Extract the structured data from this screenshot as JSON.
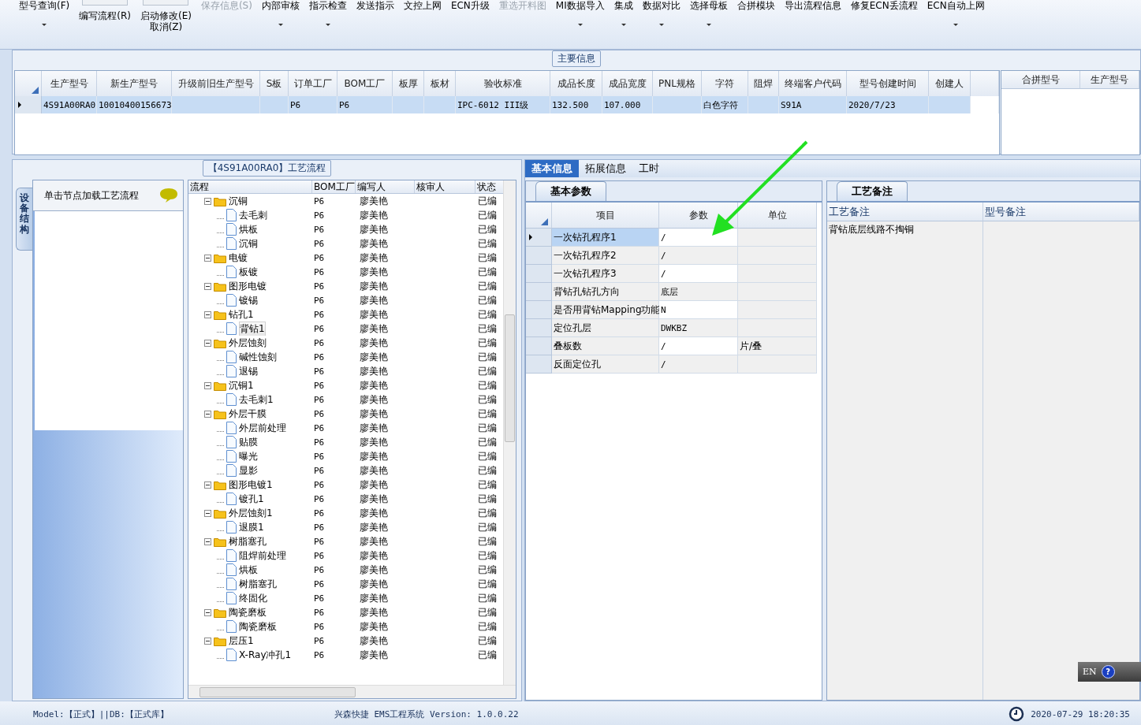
{
  "toolbar": [
    {
      "label": "型号查询(F)",
      "kind": "text",
      "dropdown": true,
      "disabled": false
    },
    {
      "label": "编写流程(R)",
      "kind": "stacked",
      "dropdown": false,
      "disabled": false
    },
    {
      "label": "启动修改(E)",
      "sublabel": "取消(Z)",
      "kind": "stacked",
      "dropdown": false,
      "disabled": false
    },
    {
      "label": "保存信息(S)",
      "kind": "text",
      "dropdown": false,
      "disabled": true
    },
    {
      "label": "内部审核",
      "kind": "text",
      "dropdown": true,
      "disabled": false
    },
    {
      "label": "指示检查",
      "kind": "text",
      "dropdown": true,
      "disabled": false
    },
    {
      "label": "发送指示",
      "kind": "text",
      "dropdown": false,
      "disabled": false
    },
    {
      "label": "文控上网",
      "kind": "text",
      "dropdown": false,
      "disabled": false
    },
    {
      "label": "ECN升级",
      "kind": "text",
      "dropdown": false,
      "disabled": false
    },
    {
      "label": "重选开料图",
      "kind": "text",
      "dropdown": false,
      "disabled": true
    },
    {
      "label": "MI数据导入",
      "kind": "text",
      "dropdown": true,
      "disabled": false
    },
    {
      "label": "集成",
      "kind": "text",
      "dropdown": true,
      "disabled": false
    },
    {
      "label": "数据对比",
      "kind": "text",
      "dropdown": true,
      "disabled": false
    },
    {
      "label": "选择母板",
      "kind": "text",
      "dropdown": true,
      "disabled": false
    },
    {
      "label": "合拼模块",
      "kind": "text",
      "dropdown": false,
      "disabled": false
    },
    {
      "label": "导出流程信息",
      "kind": "text",
      "dropdown": false,
      "disabled": false
    },
    {
      "label": "修复ECN丢流程",
      "kind": "text",
      "dropdown": false,
      "disabled": false
    },
    {
      "label": "ECN自动上网",
      "kind": "text",
      "dropdown": true,
      "disabled": false
    }
  ],
  "main_info": {
    "title": "主要信息",
    "columns": [
      "生产型号",
      "新生产型号",
      "升级前旧生产型号",
      "S板",
      "订单工厂",
      "BOM工厂",
      "板厚",
      "板材",
      "验收标准",
      "成品长度",
      "成品宽度",
      "PNL规格",
      "字符",
      "阻焊",
      "终端客户代码",
      "型号创建时间",
      "创建人"
    ],
    "rows": [
      {
        "selected": true,
        "cells": [
          "4S91A00RA0",
          "10010400156673",
          null,
          null,
          "P6",
          "P6",
          null,
          null,
          "IPC-6012 III级",
          "132.500",
          "107.000",
          null,
          "白色字符",
          null,
          "S91A",
          "2020/7/23",
          null
        ]
      }
    ],
    "merge_columns": [
      "合拼型号",
      "生产型号"
    ]
  },
  "process_panel": {
    "title": "【4S91A00RA0】工艺流程",
    "side_tab": "设备结构",
    "hint": "单击节点加载工艺流程",
    "columns": [
      "流程",
      "BOM工厂",
      "编写人",
      "核审人",
      "状态"
    ],
    "nodes": [
      {
        "kind": "folder",
        "name": "沉铜",
        "bom": "P6",
        "writer": "廖美艳",
        "status": "已编",
        "selected": false,
        "expanded": true,
        "children": [
          {
            "kind": "file",
            "name": "去毛刺",
            "bom": "P6",
            "writer": "廖美艳",
            "status": "已编",
            "selected": false
          },
          {
            "kind": "file",
            "name": "烘板",
            "bom": "P6",
            "writer": "廖美艳",
            "status": "已编",
            "selected": false
          },
          {
            "kind": "file",
            "name": "沉铜",
            "bom": "P6",
            "writer": "廖美艳",
            "status": "已编",
            "selected": false
          }
        ]
      },
      {
        "kind": "folder",
        "name": "电镀",
        "bom": "P6",
        "writer": "廖美艳",
        "status": "已编",
        "selected": false,
        "expanded": true,
        "children": [
          {
            "kind": "file",
            "name": "板镀",
            "bom": "P6",
            "writer": "廖美艳",
            "status": "已编",
            "selected": false
          }
        ]
      },
      {
        "kind": "folder",
        "name": "图形电镀",
        "bom": "P6",
        "writer": "廖美艳",
        "status": "已编",
        "selected": false,
        "expanded": true,
        "children": [
          {
            "kind": "file",
            "name": "镀锡",
            "bom": "P6",
            "writer": "廖美艳",
            "status": "已编",
            "selected": false
          }
        ]
      },
      {
        "kind": "folder",
        "name": "钻孔1",
        "bom": "P6",
        "writer": "廖美艳",
        "status": "已编",
        "selected": false,
        "expanded": true,
        "children": [
          {
            "kind": "file",
            "name": "背钻1",
            "bom": "P6",
            "writer": "廖美艳",
            "status": "已编",
            "selected": true
          }
        ]
      },
      {
        "kind": "folder",
        "name": "外层蚀刻",
        "bom": "P6",
        "writer": "廖美艳",
        "status": "已编",
        "selected": false,
        "expanded": true,
        "children": [
          {
            "kind": "file",
            "name": "碱性蚀刻",
            "bom": "P6",
            "writer": "廖美艳",
            "status": "已编",
            "selected": false
          },
          {
            "kind": "file",
            "name": "退锡",
            "bom": "P6",
            "writer": "廖美艳",
            "status": "已编",
            "selected": false
          }
        ]
      },
      {
        "kind": "folder",
        "name": "沉铜1",
        "bom": "P6",
        "writer": "廖美艳",
        "status": "已编",
        "selected": false,
        "expanded": true,
        "children": [
          {
            "kind": "file",
            "name": "去毛刺1",
            "bom": "P6",
            "writer": "廖美艳",
            "status": "已编",
            "selected": false
          }
        ]
      },
      {
        "kind": "folder",
        "name": "外层干膜",
        "bom": "P6",
        "writer": "廖美艳",
        "status": "已编",
        "selected": false,
        "expanded": true,
        "children": [
          {
            "kind": "file",
            "name": "外层前处理",
            "bom": "P6",
            "writer": "廖美艳",
            "status": "已编",
            "selected": false
          },
          {
            "kind": "file",
            "name": "贴膜",
            "bom": "P6",
            "writer": "廖美艳",
            "status": "已编",
            "selected": false
          },
          {
            "kind": "file",
            "name": "曝光",
            "bom": "P6",
            "writer": "廖美艳",
            "status": "已编",
            "selected": false
          },
          {
            "kind": "file",
            "name": "显影",
            "bom": "P6",
            "writer": "廖美艳",
            "status": "已编",
            "selected": false
          }
        ]
      },
      {
        "kind": "folder",
        "name": "图形电镀1",
        "bom": "P6",
        "writer": "廖美艳",
        "status": "已编",
        "selected": false,
        "expanded": true,
        "children": [
          {
            "kind": "file",
            "name": "镀孔1",
            "bom": "P6",
            "writer": "廖美艳",
            "status": "已编",
            "selected": false
          }
        ]
      },
      {
        "kind": "folder",
        "name": "外层蚀刻1",
        "bom": "P6",
        "writer": "廖美艳",
        "status": "已编",
        "selected": false,
        "expanded": true,
        "children": [
          {
            "kind": "file",
            "name": "退膜1",
            "bom": "P6",
            "writer": "廖美艳",
            "status": "已编",
            "selected": false
          }
        ]
      },
      {
        "kind": "folder",
        "name": "树脂塞孔",
        "bom": "P6",
        "writer": "廖美艳",
        "status": "已编",
        "selected": false,
        "expanded": true,
        "children": [
          {
            "kind": "file",
            "name": "阻焊前处理",
            "bom": "P6",
            "writer": "廖美艳",
            "status": "已编",
            "selected": false
          },
          {
            "kind": "file",
            "name": "烘板",
            "bom": "P6",
            "writer": "廖美艳",
            "status": "已编",
            "selected": false
          },
          {
            "kind": "file",
            "name": "树脂塞孔",
            "bom": "P6",
            "writer": "廖美艳",
            "status": "已编",
            "selected": false
          },
          {
            "kind": "file",
            "name": "终固化",
            "bom": "P6",
            "writer": "廖美艳",
            "status": "已编",
            "selected": false
          }
        ]
      },
      {
        "kind": "folder",
        "name": "陶瓷磨板",
        "bom": "P6",
        "writer": "廖美艳",
        "status": "已编",
        "selected": false,
        "expanded": true,
        "children": [
          {
            "kind": "file",
            "name": "陶瓷磨板",
            "bom": "P6",
            "writer": "廖美艳",
            "status": "已编",
            "selected": false
          }
        ]
      },
      {
        "kind": "folder",
        "name": "层压1",
        "bom": "P6",
        "writer": "廖美艳",
        "status": "已编",
        "selected": false,
        "expanded": true,
        "children": [
          {
            "kind": "file",
            "name": "X-Ray冲孔1",
            "bom": "P6",
            "writer": "廖美艳",
            "status": "已编",
            "selected": false
          }
        ]
      }
    ]
  },
  "detail_tabs": [
    {
      "label": "基本信息",
      "selected": true
    },
    {
      "label": "拓展信息",
      "selected": false
    },
    {
      "label": "工时",
      "selected": false
    }
  ],
  "params": {
    "tab": "基本参数",
    "columns": [
      "项目",
      "参数",
      "单位"
    ],
    "rows": [
      {
        "item": "一次钻孔程序1",
        "value": "/",
        "selected": true
      },
      {
        "item": "一次钻孔程序2",
        "value": "/",
        "selected": false
      },
      {
        "item": "一次钻孔程序3",
        "value": "/",
        "selected": false
      },
      {
        "item": "背钻孔钻孔方向",
        "value": "底层",
        "selected": false
      },
      {
        "item": "是否用背钻Mapping功能",
        "value": "N",
        "selected": false
      },
      {
        "item": "定位孔层",
        "value": "DWKBZ",
        "selected": false
      },
      {
        "item": "叠板数",
        "value": "/",
        "unit": "片/叠",
        "selected": false
      },
      {
        "item": "反面定位孔",
        "value": "/",
        "selected": false
      }
    ]
  },
  "notes": {
    "tab": "工艺备注",
    "columns": [
      "工艺备注",
      "型号备注"
    ],
    "process_note": "背钻底层线路不掏铜"
  },
  "ime": {
    "language": "EN",
    "help": "?"
  },
  "status_bar": {
    "model": "Model:【正式】||DB:【正式库】",
    "system": "兴森快捷 EMS工程系统 Version: 1.0.0.22",
    "datetime": "2020-07-29 18:20:35"
  }
}
